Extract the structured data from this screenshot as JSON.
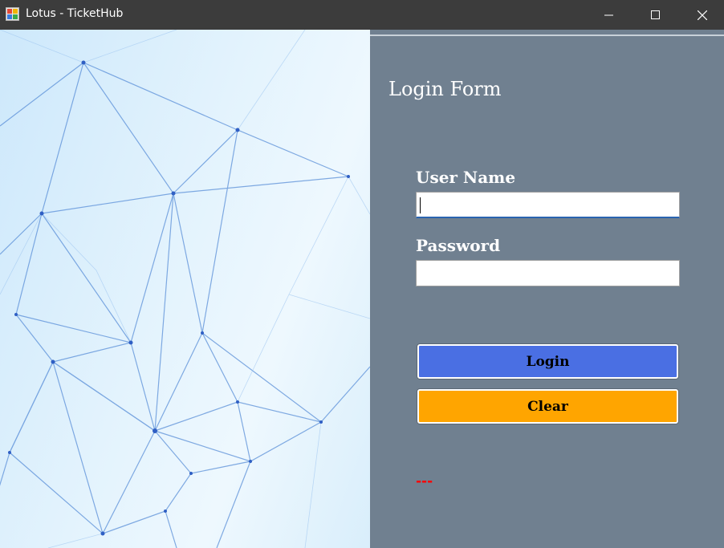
{
  "window": {
    "title": "Lotus - TicketHub",
    "icons": {
      "app": "app-window-icon",
      "minimize": "minimize-icon",
      "maximize": "maximize-icon",
      "close": "close-icon"
    }
  },
  "form": {
    "title": "Login Form",
    "username_label": "User Name",
    "username_value": "",
    "password_label": "Password",
    "password_value": "",
    "login_button": "Login",
    "clear_button": "Clear",
    "status_message": "---"
  },
  "colors": {
    "titlebar": "#3c3c3c",
    "panel": "#708090",
    "login_button": "#4a6fe3",
    "clear_button": "#ffa500",
    "status_text": "#ff0000"
  }
}
